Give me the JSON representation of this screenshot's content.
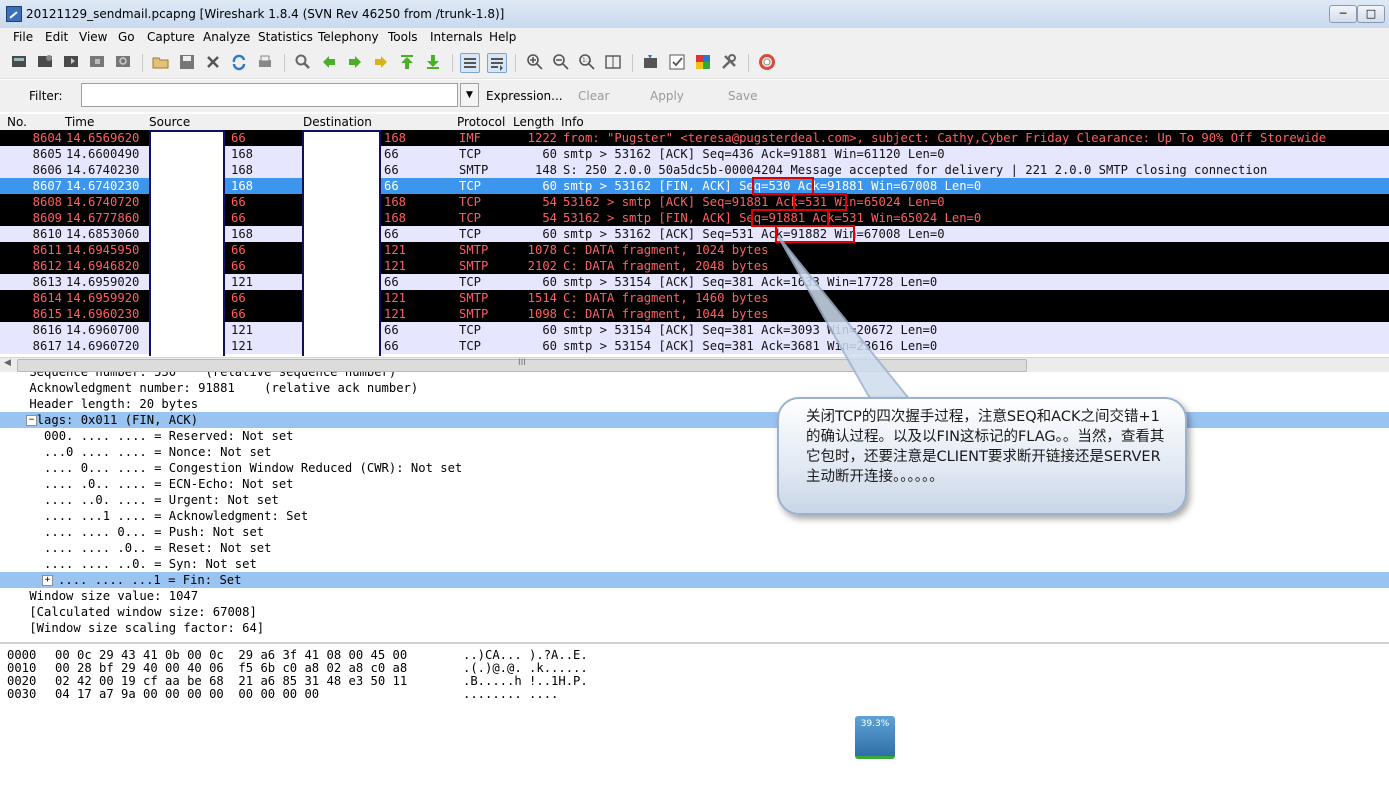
{
  "window": {
    "title": "20121129_sendmail.pcapng  [Wireshark 1.8.4  (SVN Rev 46250 from /trunk-1.8)]",
    "buttons": [
      "─",
      "□"
    ]
  },
  "menu": [
    "File",
    "Edit",
    "View",
    "Go",
    "Capture",
    "Analyze",
    "Statistics",
    "Telephony",
    "Tools",
    "Internals",
    "Help"
  ],
  "filter": {
    "label": "Filter:",
    "value": "",
    "placeholder": "",
    "expression": "Expression...",
    "clear": "Clear",
    "apply": "Apply",
    "save": "Save"
  },
  "packet_list": {
    "columns": [
      "No.",
      "Time",
      "Source",
      "Destination",
      "Protocol",
      "Length",
      "Info"
    ],
    "rows": [
      {
        "no": "8604",
        "time": "14.6569620",
        "src": "66",
        "dst": "168",
        "proto": "IMF",
        "len": "1222",
        "info": "from: \"Pugster\" <teresa@pugsterdeal.com>, subject: Cathy,Cyber Friday Clearance: Up To 90% Off Storewide",
        "style": "black"
      },
      {
        "no": "8605",
        "time": "14.6600490",
        "src": "168",
        "dst": "66",
        "proto": "TCP",
        "len": "60",
        "info": "smtp > 53162 [ACK] Seq=436 Ack=91881 Win=61120 Len=0",
        "style": "lav"
      },
      {
        "no": "8606",
        "time": "14.6740230",
        "src": "168",
        "dst": "66",
        "proto": "SMTP",
        "len": "148",
        "info": "S: 250 2.0.0 50a5dc5b-00004204 Message accepted for delivery | 221 2.0.0 SMTP closing connection",
        "style": "lav"
      },
      {
        "no": "8607",
        "time": "14.6740230",
        "src": "168",
        "dst": "66",
        "proto": "TCP",
        "len": "60",
        "info": "smtp > 53162 [FIN, ACK] Seq=530 Ack=91881 Win=67008 Len=0",
        "style": "sel"
      },
      {
        "no": "8608",
        "time": "14.6740720",
        "src": "66",
        "dst": "168",
        "proto": "TCP",
        "len": "54",
        "info": "53162 > smtp [ACK] Seq=91881 Ack=531 Win=65024 Len=0",
        "style": "black"
      },
      {
        "no": "8609",
        "time": "14.6777860",
        "src": "66",
        "dst": "168",
        "proto": "TCP",
        "len": "54",
        "info": "53162 > smtp [FIN, ACK] Seq=91881 Ack=531 Win=65024 Len=0",
        "style": "black"
      },
      {
        "no": "8610",
        "time": "14.6853060",
        "src": "168",
        "dst": "66",
        "proto": "TCP",
        "len": "60",
        "info": "smtp > 53162 [ACK] Seq=531 Ack=91882 Win=67008 Len=0",
        "style": "lav"
      },
      {
        "no": "8611",
        "time": "14.6945950",
        "src": "66",
        "dst": "121",
        "proto": "SMTP",
        "len": "1078",
        "info": "C: DATA fragment, 1024 bytes",
        "style": "black"
      },
      {
        "no": "8612",
        "time": "14.6946820",
        "src": "66",
        "dst": "121",
        "proto": "SMTP",
        "len": "2102",
        "info": "C: DATA fragment, 2048 bytes",
        "style": "black"
      },
      {
        "no": "8613",
        "time": "14.6959020",
        "src": "121",
        "dst": "66",
        "proto": "TCP",
        "len": "60",
        "info": "smtp > 53154 [ACK] Seq=381 Ack=1633 Win=17728 Len=0",
        "style": "lav"
      },
      {
        "no": "8614",
        "time": "14.6959920",
        "src": "66",
        "dst": "121",
        "proto": "SMTP",
        "len": "1514",
        "info": "C: DATA fragment, 1460 bytes",
        "style": "black"
      },
      {
        "no": "8615",
        "time": "14.6960230",
        "src": "66",
        "dst": "121",
        "proto": "SMTP",
        "len": "1098",
        "info": "C: DATA fragment, 1044 bytes",
        "style": "black"
      },
      {
        "no": "8616",
        "time": "14.6960700",
        "src": "121",
        "dst": "66",
        "proto": "TCP",
        "len": "60",
        "info": "smtp > 53154 [ACK] Seq=381 Ack=3093 Win=20672 Len=0",
        "style": "lav"
      },
      {
        "no": "8617",
        "time": "14.6960720",
        "src": "121",
        "dst": "66",
        "proto": "TCP",
        "len": "60",
        "info": "smtp > 53154 [ACK] Seq=381 Ack=3681 Win=23616 Len=0",
        "style": "lav"
      }
    ],
    "scroll_marker": "III"
  },
  "details": [
    {
      "text": "    Sequence number: 530    (relative sequence number)",
      "hl": false,
      "expander": ""
    },
    {
      "text": "    Acknowledgment number: 91881    (relative ack number)",
      "hl": false,
      "expander": ""
    },
    {
      "text": "    Header length: 20 bytes",
      "hl": false,
      "expander": ""
    },
    {
      "text": "    Flags: 0x011 (FIN, ACK)",
      "hl": true,
      "expander": "−"
    },
    {
      "text": "      000. .... .... = Reserved: Not set",
      "hl": false,
      "expander": ""
    },
    {
      "text": "      ...0 .... .... = Nonce: Not set",
      "hl": false,
      "expander": ""
    },
    {
      "text": "      .... 0... .... = Congestion Window Reduced (CWR): Not set",
      "hl": false,
      "expander": ""
    },
    {
      "text": "      .... .0.. .... = ECN-Echo: Not set",
      "hl": false,
      "expander": ""
    },
    {
      "text": "      .... ..0. .... = Urgent: Not set",
      "hl": false,
      "expander": ""
    },
    {
      "text": "      .... ...1 .... = Acknowledgment: Set",
      "hl": false,
      "expander": ""
    },
    {
      "text": "      .... .... 0... = Push: Not set",
      "hl": false,
      "expander": ""
    },
    {
      "text": "      .... .... .0.. = Reset: Not set",
      "hl": false,
      "expander": ""
    },
    {
      "text": "      .... .... ..0. = Syn: Not set",
      "hl": false,
      "expander": ""
    },
    {
      "text": "      .... .... ...1 = Fin: Set",
      "hl": true,
      "expander": "+"
    },
    {
      "text": "    Window size value: 1047",
      "hl": false,
      "expander": ""
    },
    {
      "text": "    [Calculated window size: 67008]",
      "hl": false,
      "expander": ""
    },
    {
      "text": "    [Window size scaling factor: 64]",
      "hl": false,
      "expander": ""
    }
  ],
  "bytes": [
    {
      "offset": "0000",
      "hex": "00 0c 29 43 41 0b 00 0c  29 a6 3f 41 08 00 45 00",
      "ascii": "..)CA... ).?A..E."
    },
    {
      "offset": "0010",
      "hex": "00 28 bf 29 40 00 40 06  f5 6b c0 a8 02 a8 c0 a8",
      "ascii": ".(.)@.@. .k......"
    },
    {
      "offset": "0020",
      "hex": "02 42 00 19 cf aa be 68  21 a6 85 31 48 e3 50 11",
      "ascii": ".B.....h !..1H.P."
    },
    {
      "offset": "0030",
      "hex": "04 17 a7 9a 00 00 00 00  00 00 00 00",
      "ascii": "........ ...."
    }
  ],
  "callout": {
    "text": "关闭TCP的四次握手过程，注意SEQ和ACK之间交错+1的确认过程。以及以FIN这标记的FLAG。。当然，查看其它包时，还要注意是CLIENT要求断开链接还是SERVER主动断开连接。。。。。。"
  },
  "badge": "39.3%",
  "colors": {
    "selected_row": "#3d96ed",
    "black_row": "#000000",
    "black_row_text": "#ff5f5f",
    "lavender_row": "#e7e6ff",
    "highlight": "#99c3f0",
    "annotation_box": "#e00000"
  }
}
